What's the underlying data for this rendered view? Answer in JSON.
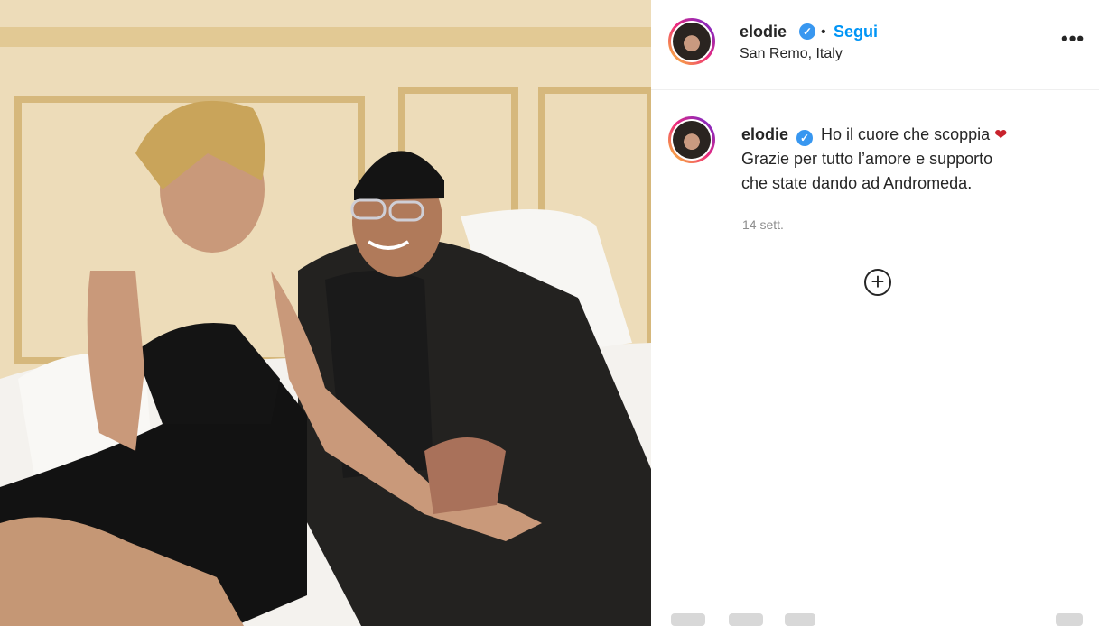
{
  "post": {
    "username": "elodie",
    "follow_label": "Segui",
    "separator": "•",
    "location": "San Remo, Italy",
    "more_icon": "more-options-icon",
    "caption_user": "elodie",
    "caption_line1": "Ho il cuore che scoppia",
    "caption_emoji": "❤",
    "caption_line2": "Grazie per tutto l’amore e supporto",
    "caption_line3": "che state dando ad Andromeda.",
    "timestamp": "14 sett.",
    "load_more_icon": "plus-circle-icon",
    "verified_icon": "verified-badge-icon"
  },
  "colors": {
    "accent": "#0095f6",
    "verified": "#3897f0",
    "heart": "#c8222c"
  }
}
